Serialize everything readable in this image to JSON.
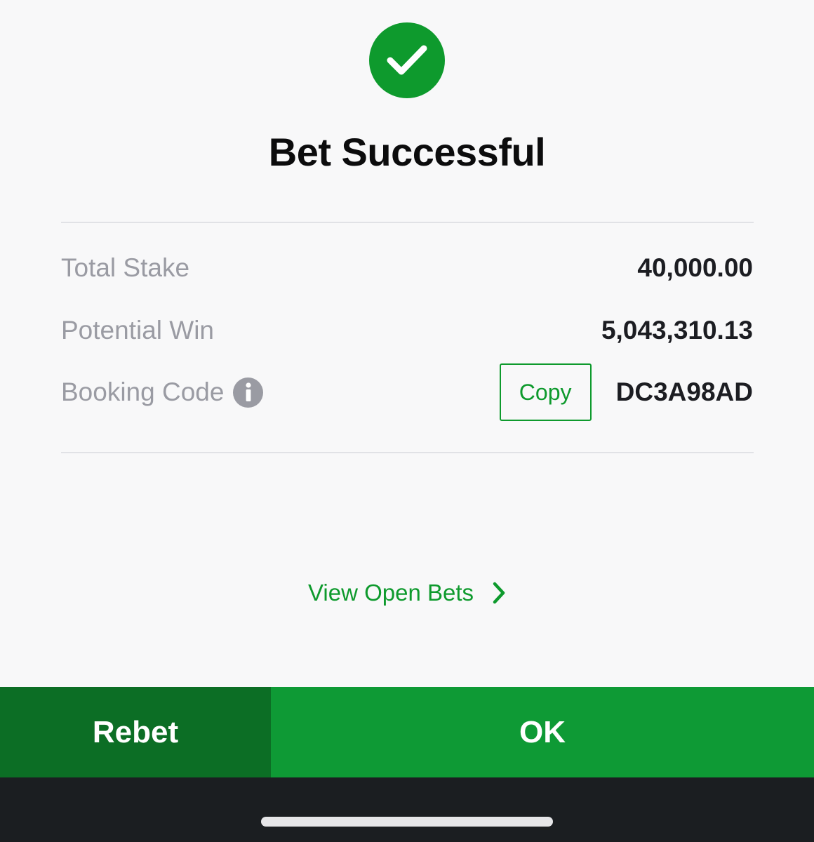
{
  "icons": {
    "success": "check-circle-icon",
    "info": "info-icon",
    "chevron": "chevron-right-icon"
  },
  "colors": {
    "accent_green": "#0e9a2d",
    "rebet_green": "#0c6e25",
    "ok_green": "#0e9a35",
    "label_gray": "#9a9ba3",
    "value_dark": "#1c1d22",
    "home_bar_bg": "#1b1e21"
  },
  "header": {
    "title": "Bet Successful"
  },
  "summary": {
    "total_stake_label": "Total Stake",
    "total_stake_value": "40,000.00",
    "potential_win_label": "Potential Win",
    "potential_win_value": "5,043,310.13",
    "booking_code_label": "Booking Code",
    "copy_label": "Copy",
    "booking_code_value": "DC3A98AD"
  },
  "links": {
    "view_open_bets": "View Open Bets"
  },
  "footer": {
    "rebet_label": "Rebet",
    "ok_label": "OK"
  }
}
